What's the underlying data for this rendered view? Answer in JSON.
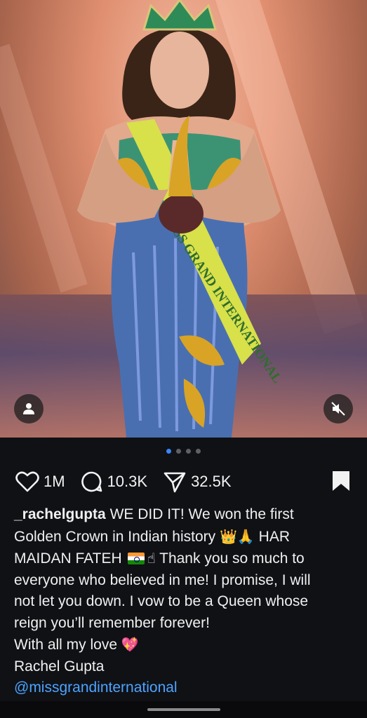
{
  "post": {
    "media": {
      "carousel_total": 4,
      "carousel_active_index": 0,
      "sash_text": "MISS GRAND INTERNATIONAL"
    },
    "stats": {
      "likes": "1M",
      "comments": "10.3K",
      "shares": "32.5K"
    },
    "caption": {
      "username": "_rachelgupta",
      "line1": "WE DID IT! We won the first",
      "line2": "Golden Crown in Indian history",
      "line3a": "HAR",
      "line3b": "MAIDAN FATEH",
      "line3c": "Thank you so much to",
      "line4": "everyone who believed in me! I promise, I will",
      "line5": "not let you down. I vow to be a Queen whose",
      "line6": "reign you’ll remember forever!",
      "line7": "With all my love",
      "line8": "Rachel Gupta",
      "mention": "@missgrandinternational"
    },
    "emojis": {
      "crown": "👑",
      "pray": "🙏",
      "point_up": "☝",
      "heart": "💖"
    }
  },
  "colors": {
    "background": "#0f1115",
    "active_dot": "#3a86ff",
    "mention": "#4da3ff",
    "sash": "#d8e04a",
    "trophy": "#d9a326"
  },
  "icons": [
    "user-tag-icon",
    "mute-icon",
    "heart-icon",
    "comment-icon",
    "share-icon",
    "bookmark-icon"
  ]
}
